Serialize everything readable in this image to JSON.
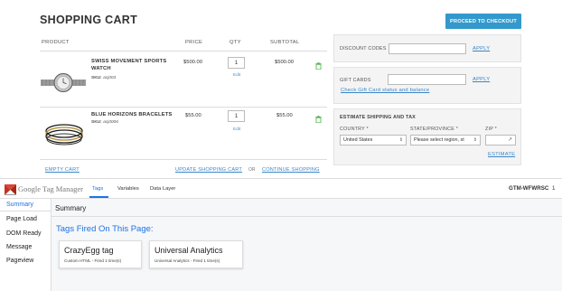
{
  "cart": {
    "title": "SHOPPING CART",
    "checkout_label": "PROCEED TO CHECKOUT",
    "columns": [
      "PRODUCT",
      "PRICE",
      "QTY",
      "SUBTOTAL"
    ],
    "items": [
      {
        "name_line1": "SWISS MOVEMENT SPORTS",
        "name_line2": "WATCH",
        "sku_label": "SKU:",
        "sku": "acj003",
        "price": "$500.00",
        "qty": "1",
        "edit": "Edit",
        "subtotal": "$500.00",
        "image": "watch-image"
      },
      {
        "name_line1": "BLUE HORIZONS BRACELETS",
        "name_line2": "",
        "sku_label": "SKU:",
        "sku": "acj0006",
        "price": "$55.00",
        "qty": "1",
        "edit": "Edit",
        "subtotal": "$55.00",
        "image": "bracelets-image"
      }
    ],
    "empty_cart": "EMPTY CART",
    "update_cart": "UPDATE SHOPPING CART",
    "or": "OR",
    "continue_shopping": "CONTINUE SHOPPING"
  },
  "side": {
    "discount_label": "DISCOUNT CODES",
    "discount_apply": "APPLY",
    "giftcards_label": "GIFT CARDS",
    "giftcards_apply": "APPLY",
    "giftcard_status_link": "Check Gift Card status and balance",
    "estimate_title": "ESTIMATE SHIPPING AND TAX",
    "country_label": "COUNTRY *",
    "country_value": "United States",
    "state_label": "STATE/PROVINCE *",
    "state_value": "Please select region, st",
    "zip_label": "ZIP *",
    "estimate_link": "ESTIMATE"
  },
  "gtm": {
    "logo_text": "Google Tag Manager",
    "tabs": [
      "Tags",
      "Variables",
      "Data Layer"
    ],
    "active_tab": "Tags",
    "container_id": "GTM-WFWRSC",
    "count": "1",
    "sidebar": [
      "Summary",
      "Page Load",
      "DOM Ready",
      "Message",
      "Pageview"
    ],
    "main_title": "Summary",
    "fired_heading": "Tags Fired On This Page:",
    "tags": [
      {
        "title": "CrazyEgg tag",
        "subtitle": "Custom HTML - Fired 1 time(s)"
      },
      {
        "title": "Universal Analytics",
        "subtitle": "Universal Analytics - Fired 1 time(s)"
      }
    ]
  },
  "colors": {
    "accent": "#3399cc",
    "link": "#3a86c8",
    "gtm_blue": "#1a73e8",
    "trash": "#5fb85f"
  }
}
